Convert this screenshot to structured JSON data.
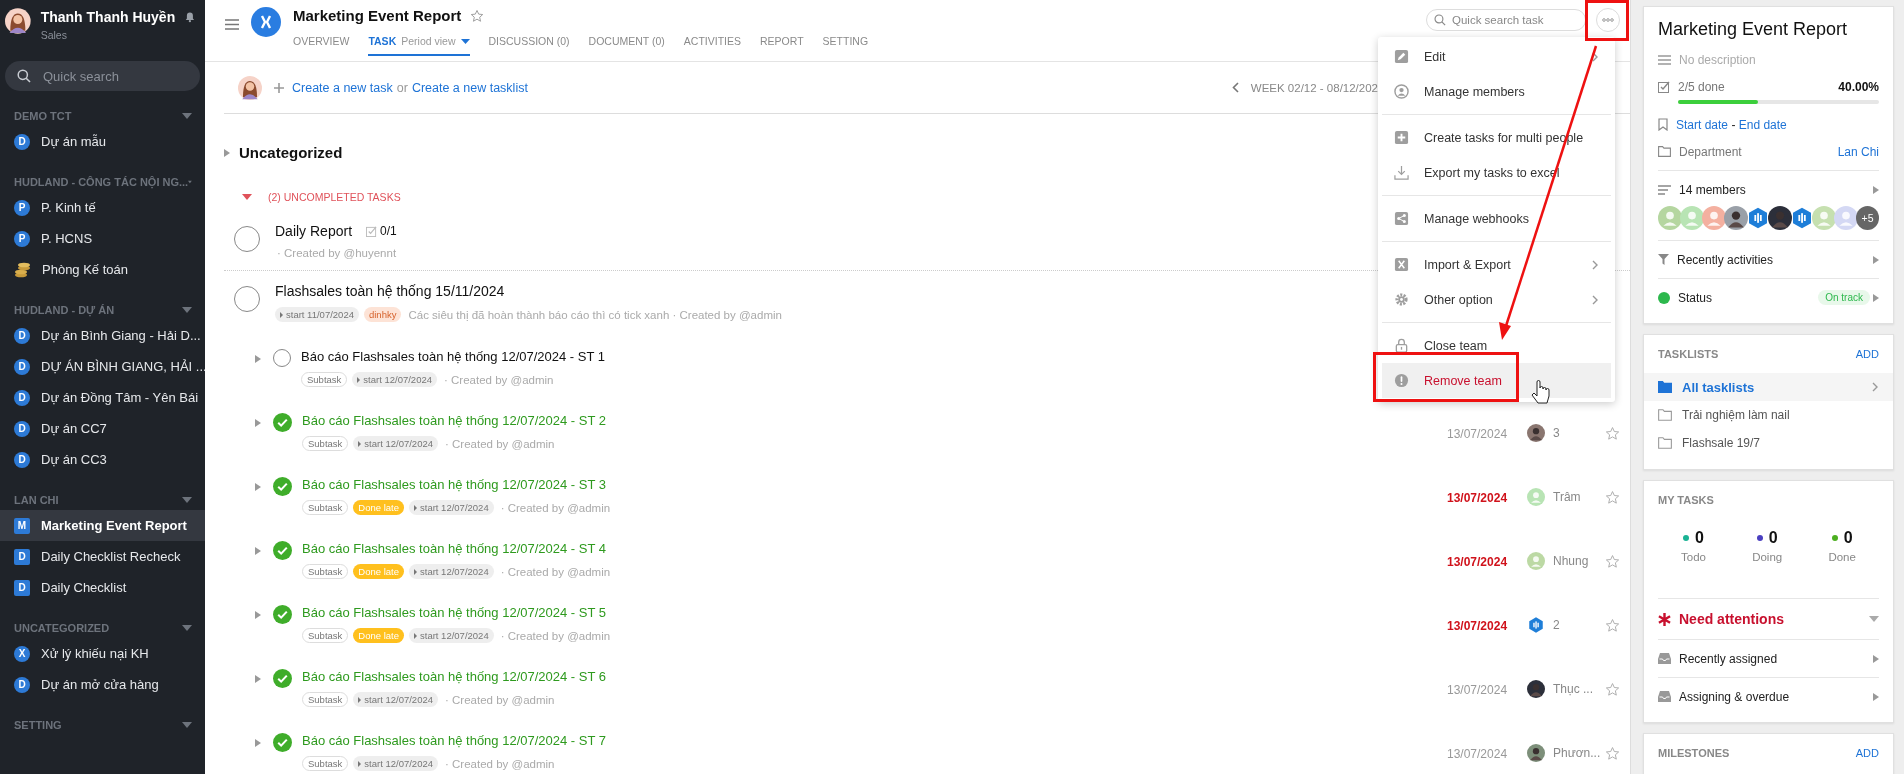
{
  "sidebar": {
    "user": {
      "name": "Thanh Thanh Huyền",
      "role": "Sales"
    },
    "search": {
      "placeholder": "Quick search"
    },
    "sections": [
      {
        "title": "DEMO TCT",
        "items": [
          {
            "label": "Dự án mẫu",
            "kind": "circle",
            "badge": "D",
            "selected": false
          }
        ]
      },
      {
        "title": "HUDLAND - CÔNG TÁC NỘI NG...",
        "items": [
          {
            "label": "P. Kinh tế",
            "kind": "circle",
            "badge": "P",
            "selected": false
          },
          {
            "label": "P. HCNS",
            "kind": "circle",
            "badge": "P",
            "selected": false
          },
          {
            "label": "Phòng Kế toán",
            "kind": "coins",
            "selected": false
          }
        ]
      },
      {
        "title": "HUDLAND - DỰ ÁN",
        "items": [
          {
            "label": "Dự án Bình Giang - Hải D...",
            "kind": "circle",
            "badge": "D",
            "selected": false
          },
          {
            "label": "DỰ ÁN BÌNH GIANG, HẢI ...",
            "kind": "circle",
            "badge": "D",
            "selected": false
          },
          {
            "label": "Dự án Đồng Tâm - Yên Bái",
            "kind": "circle",
            "badge": "D",
            "selected": false
          },
          {
            "label": "Dự án CC7",
            "kind": "circle",
            "badge": "D",
            "selected": false
          },
          {
            "label": "Dự án CC3",
            "kind": "circle",
            "badge": "D",
            "selected": false
          }
        ]
      },
      {
        "title": "LAN CHI",
        "items": [
          {
            "label": "Marketing Event Report",
            "kind": "square",
            "badge": "M",
            "selected": true
          },
          {
            "label": "Daily Checklist Recheck",
            "kind": "square",
            "badge": "D",
            "selected": false
          },
          {
            "label": "Daily Checklist",
            "kind": "square",
            "badge": "D",
            "selected": false
          }
        ]
      },
      {
        "title": "UNCATEGORIZED",
        "items": [
          {
            "label": "Xử lý khiếu nại KH",
            "kind": "circle",
            "badge": "X",
            "selected": false
          },
          {
            "label": "Dự án mở cửa hàng",
            "kind": "circle",
            "badge": "D",
            "selected": false
          }
        ]
      },
      {
        "title": "SETTING"
      }
    ]
  },
  "header": {
    "title": "Marketing Event Report",
    "search": {
      "placeholder": "Quick search task"
    },
    "tabs": [
      {
        "label": "OVERVIEW",
        "selected": false
      },
      {
        "label": "TASK",
        "sub": "Period view",
        "selected": true
      },
      {
        "label": "DISCUSSION (0)",
        "selected": false
      },
      {
        "label": "DOCUMENT (0)",
        "selected": false
      },
      {
        "label": "ACTIVITIES",
        "selected": false
      },
      {
        "label": "REPORT",
        "selected": false
      },
      {
        "label": "SETTING",
        "selected": false
      }
    ]
  },
  "toolbar": {
    "create_task": "Create a new task",
    "joiner": "or",
    "create_tasklist": "Create a new tasklist",
    "week": "WEEK 02/12 - 08/12/202"
  },
  "group": {
    "title": "Uncategorized",
    "section": "(2) UNCOMPLETED TASKS",
    "tasks": [
      {
        "title": "Daily Report",
        "done": false,
        "checklist": "0/1",
        "meta": "· Created by @huyennt"
      },
      {
        "title": "Flashsales toàn hệ thống 15/11/2024",
        "done": false,
        "tags": [
          {
            "kind": "start",
            "text": "start 11/07/2024"
          },
          {
            "kind": "label",
            "text": "dinhky"
          }
        ],
        "meta": "Các siêu thị đã hoàn thành báo cáo thì có tick xanh · Created by @admin"
      }
    ],
    "subtasks": [
      {
        "title": "Báo cáo Flashsales toàn hệ thống 12/07/2024 - ST 1",
        "done": false,
        "tags": [
          {
            "kind": "subtask",
            "text": "Subtask"
          },
          {
            "kind": "start",
            "text": "start 12/07/2024"
          }
        ],
        "meta": "· Created by @admin"
      },
      {
        "title": "Báo cáo Flashsales toàn hệ thống 12/07/2024 - ST 2",
        "done": true,
        "tags": [
          {
            "kind": "subtask",
            "text": "Subtask"
          },
          {
            "kind": "start",
            "text": "start 12/07/2024"
          }
        ],
        "meta": "· Created by @admin",
        "due": "13/07/2024",
        "overdue": false,
        "assignee": {
          "kind": "photo",
          "color": "#8a7670",
          "name": "3"
        }
      },
      {
        "title": "Báo cáo Flashsales toàn hệ thống 12/07/2024 - ST 3",
        "done": true,
        "tags": [
          {
            "kind": "subtask",
            "text": "Subtask"
          },
          {
            "kind": "late",
            "text": "Done late"
          },
          {
            "kind": "start",
            "text": "start 12/07/2024"
          }
        ],
        "meta": "· Created by @admin",
        "due": "13/07/2024",
        "overdue": true,
        "assignee": {
          "kind": "person",
          "color": "#b8e4b4",
          "name": "Trâm"
        }
      },
      {
        "title": "Báo cáo Flashsales toàn hệ thống 12/07/2024 - ST 4",
        "done": true,
        "tags": [
          {
            "kind": "subtask",
            "text": "Subtask"
          },
          {
            "kind": "late",
            "text": "Done late"
          },
          {
            "kind": "start",
            "text": "start 12/07/2024"
          }
        ],
        "meta": "· Created by @admin",
        "due": "13/07/2024",
        "overdue": true,
        "assignee": {
          "kind": "person",
          "color": "#bcd9a4",
          "name": "Nhung"
        }
      },
      {
        "title": "Báo cáo Flashsales toàn hệ thống 12/07/2024 - ST 5",
        "done": true,
        "tags": [
          {
            "kind": "subtask",
            "text": "Subtask"
          },
          {
            "kind": "late",
            "text": "Done late"
          },
          {
            "kind": "start",
            "text": "start 12/07/2024"
          }
        ],
        "meta": "· Created by @admin",
        "due": "13/07/2024",
        "overdue": true,
        "assignee": {
          "kind": "hex",
          "color": "#1e7ed8",
          "name": "2"
        }
      },
      {
        "title": "Báo cáo Flashsales toàn hệ thống 12/07/2024 - ST 6",
        "done": true,
        "tags": [
          {
            "kind": "subtask",
            "text": "Subtask"
          },
          {
            "kind": "start",
            "text": "start 12/07/2024"
          }
        ],
        "meta": "· Created by @admin",
        "due": "13/07/2024",
        "overdue": false,
        "assignee": {
          "kind": "photo",
          "color": "#2c2f3a",
          "name": "Thục ..."
        }
      },
      {
        "title": "Báo cáo Flashsales toàn hệ thống 12/07/2024 - ST 7",
        "done": true,
        "tags": [
          {
            "kind": "subtask",
            "text": "Subtask"
          },
          {
            "kind": "start",
            "text": "start 12/07/2024"
          }
        ],
        "meta": "· Created by @admin",
        "due": "13/07/2024",
        "overdue": false,
        "assignee": {
          "kind": "photo",
          "color": "#7d8f7a",
          "name": "Phươn..."
        }
      }
    ]
  },
  "menu": {
    "groups": [
      [
        {
          "label": "Edit",
          "kind": "edit",
          "submenu": true,
          "danger": false,
          "selected": false
        },
        {
          "label": "Manage members",
          "kind": "members",
          "submenu": false,
          "danger": false,
          "selected": false
        }
      ],
      [
        {
          "label": "Create tasks for multi people",
          "kind": "plus",
          "submenu": false,
          "danger": false,
          "selected": false
        },
        {
          "label": "Export my tasks to excel",
          "kind": "download",
          "submenu": false,
          "danger": false,
          "selected": false
        }
      ],
      [
        {
          "label": "Manage webhooks",
          "kind": "share",
          "submenu": false,
          "danger": false,
          "selected": false
        }
      ],
      [
        {
          "label": "Import & Export",
          "kind": "import",
          "submenu": true,
          "danger": false,
          "selected": false
        },
        {
          "label": "Other option",
          "kind": "gear",
          "submenu": true,
          "danger": false,
          "selected": false
        }
      ],
      [
        {
          "label": "Close team",
          "kind": "lock",
          "submenu": false,
          "danger": false,
          "selected": false
        },
        {
          "label": "Remove team",
          "kind": "alert",
          "submenu": false,
          "danger": true,
          "selected": true
        }
      ]
    ]
  },
  "panel": {
    "title": "Marketing Event Report",
    "description": "No description",
    "progress": {
      "text": "2/5 done",
      "percent": "40.00%",
      "level": 0.4
    },
    "start": "Start date",
    "dash": "-",
    "end": "End date",
    "department": {
      "label": "Department",
      "value": "Lan Chi"
    },
    "members_label": "14 members",
    "members": [
      {
        "kind": "person",
        "color": "#b5d6a0"
      },
      {
        "kind": "person",
        "color": "#b8e4b4"
      },
      {
        "kind": "person",
        "color": "#f4b0a0"
      },
      {
        "kind": "photo",
        "color": "#9aa0a8"
      },
      {
        "kind": "hex",
        "color": "#1e7ed8"
      },
      {
        "kind": "photo",
        "color": "#2c2f3a"
      },
      {
        "kind": "hex",
        "color": "#1e7ed8"
      },
      {
        "kind": "person",
        "color": "#c6e0b0"
      },
      {
        "kind": "person",
        "color": "#d4d8f4"
      }
    ],
    "members_more": "+5",
    "activities": "Recently activities",
    "status": {
      "label": "Status",
      "color": "#2db84d",
      "badge": "On track"
    }
  },
  "tasklists": {
    "title": "TASKLISTS",
    "add": "ADD",
    "items": [
      {
        "label": "All tasklists",
        "selected": true
      },
      {
        "label": "Trải nghiệm làm nail",
        "selected": false
      },
      {
        "label": "Flashsale 19/7",
        "selected": false
      }
    ]
  },
  "my_tasks": {
    "title": "MY TASKS",
    "counts": [
      {
        "value": "0",
        "label": "Todo",
        "color": "#1ab394"
      },
      {
        "value": "0",
        "label": "Doing",
        "color": "#4a3fc0"
      },
      {
        "value": "0",
        "label": "Done",
        "color": "#4caf20"
      }
    ],
    "attention": "Need attentions",
    "rows": [
      "Recently assigned",
      "Assigning & overdue"
    ]
  },
  "milestones": {
    "title": "MILESTONES",
    "add": "ADD"
  }
}
